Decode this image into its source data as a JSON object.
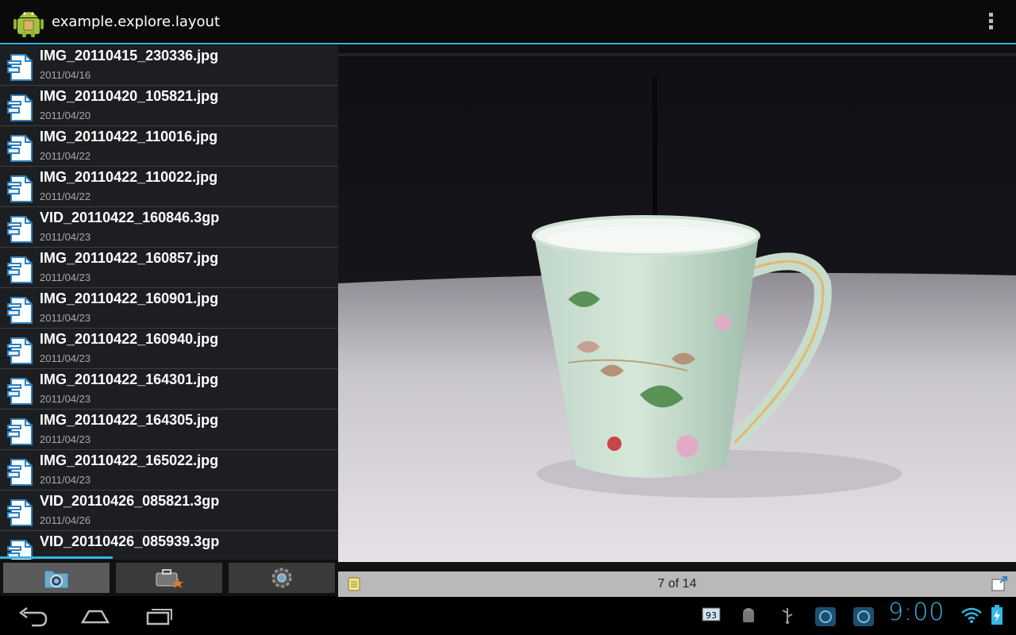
{
  "app": {
    "title": "example.explore.layout",
    "icon": "android-robot-icon",
    "overflow_icon": "overflow-menu-icon"
  },
  "files": [
    {
      "name": "IMG_20110415_230336.jpg",
      "date": "2011/04/16"
    },
    {
      "name": "IMG_20110420_105821.jpg",
      "date": "2011/04/20"
    },
    {
      "name": "IMG_20110422_110016.jpg",
      "date": "2011/04/22"
    },
    {
      "name": "IMG_20110422_110022.jpg",
      "date": "2011/04/22"
    },
    {
      "name": "VID_20110422_160846.3gp",
      "date": "2011/04/23"
    },
    {
      "name": "IMG_20110422_160857.jpg",
      "date": "2011/04/23"
    },
    {
      "name": "IMG_20110422_160901.jpg",
      "date": "2011/04/23"
    },
    {
      "name": "IMG_20110422_160940.jpg",
      "date": "2011/04/23"
    },
    {
      "name": "IMG_20110422_164301.jpg",
      "date": "2011/04/23"
    },
    {
      "name": "IMG_20110422_164305.jpg",
      "date": "2011/04/23"
    },
    {
      "name": "IMG_20110422_165022.jpg",
      "date": "2011/04/23"
    },
    {
      "name": "VID_20110426_085821.3gp",
      "date": "2011/04/26"
    },
    {
      "name": "VID_20110426_085939.3gp",
      "date": ""
    }
  ],
  "tabs": [
    {
      "icon": "folder-camera-icon",
      "active": true
    },
    {
      "icon": "toolbox-star-icon",
      "active": false
    },
    {
      "icon": "gear-settings-icon",
      "active": false
    }
  ],
  "viewer": {
    "pager_text": "7 of 14",
    "left_icon": "notes-icon",
    "right_icon": "share-edit-icon"
  },
  "status": {
    "clock": "9:00",
    "battery_level": "93"
  },
  "colors": {
    "accent": "#33b5e5",
    "list_bg": "#1c1e21"
  }
}
